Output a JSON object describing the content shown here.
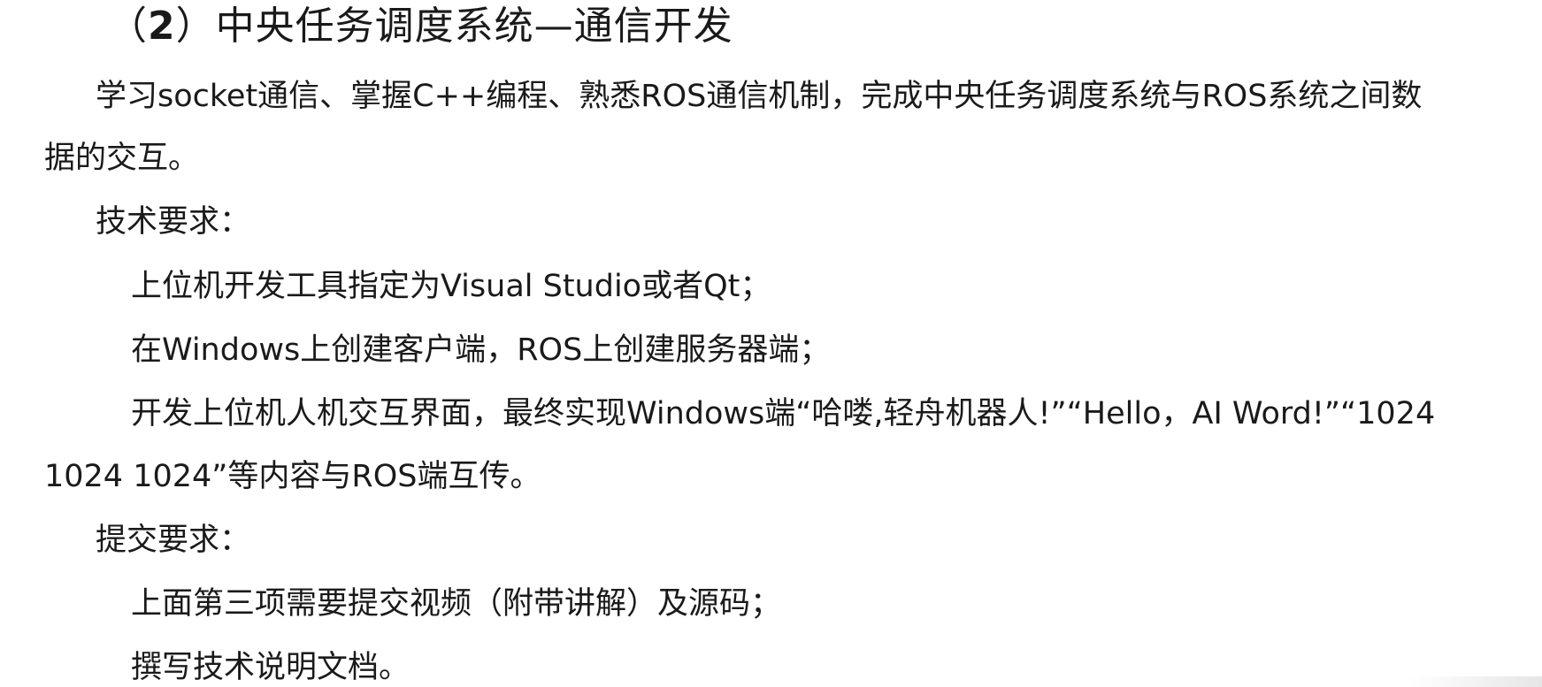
{
  "document": {
    "title_prefix": "（",
    "title_number": "2",
    "title_rest": "）中央任务调度系统—通信开发",
    "lines": [
      "学习socket通信、掌握C++编程、熟悉ROS通信机制，完成中央任务调度系统与ROS系统之间数",
      "据的交互。",
      "技术要求：",
      "上位机开发工具指定为Visual Studio或者Qt；",
      "在Windows上创建客户端，ROS上创建服务器端；",
      "开发上位机人机交互界面，最终实现Windows端“哈喽,轻舟机器人!”“Hello，AI Word!”“1024",
      "1024  1024”等内容与ROS端互传。",
      "提交要求：",
      "上面第三项需要提交视频（附带讲解）及源码；",
      "撰写技术说明文档。"
    ]
  }
}
